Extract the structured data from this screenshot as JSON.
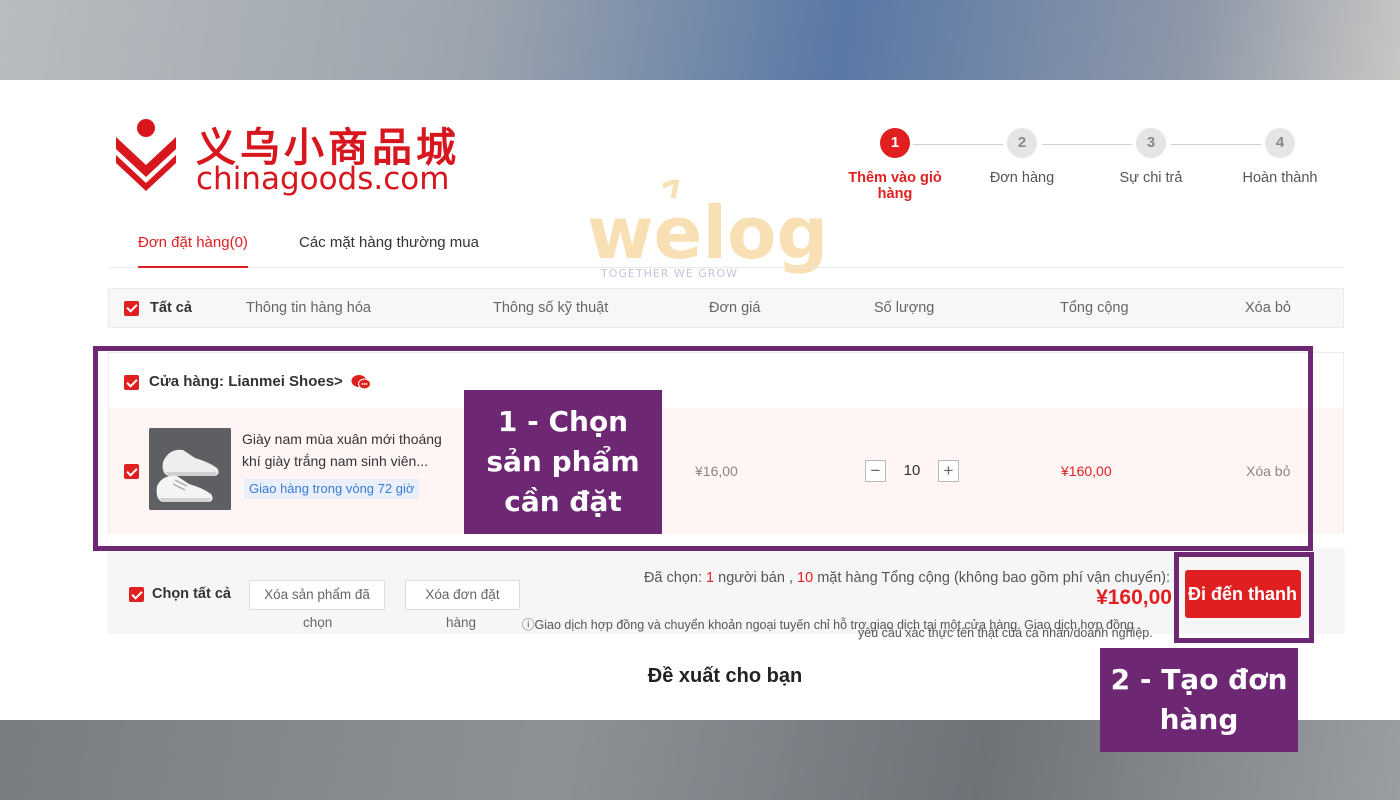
{
  "brand": {
    "logo_cn": "义乌小商品城",
    "logo_en": "chinagoods.com",
    "accent": "#e02020"
  },
  "steps": [
    {
      "num": "1",
      "label": "Thêm vào giỏ hàng",
      "active": true
    },
    {
      "num": "2",
      "label": "Đơn hàng",
      "active": false
    },
    {
      "num": "3",
      "label": "Sự chi trả",
      "active": false
    },
    {
      "num": "4",
      "label": "Hoàn thành",
      "active": false
    }
  ],
  "tabs": {
    "orders": "Đơn đặt hàng(0)",
    "frequent": "Các mặt hàng thường mua"
  },
  "watermark": {
    "word": "welog",
    "tagline": "TOGETHER WE GROW"
  },
  "table_header": {
    "all": "Tất cả",
    "product_info": "Thông tin hàng hóa",
    "specs": "Thông số kỹ thuật",
    "unit_price": "Đơn giá",
    "quantity": "Số lượng",
    "total": "Tổng cộng",
    "delete": "Xóa bỏ"
  },
  "shop": {
    "name": "Cửa hàng: Lianmei Shoes>",
    "chat_icon": "chat-icon"
  },
  "item": {
    "title_line1": "Giày nam mùa xuân mới thoáng",
    "title_line2": "khí giày trắng nam sinh viên...",
    "delivery": "Giao hàng trong vòng 72 giờ",
    "unit_price": "¥16,00",
    "quantity": "10",
    "line_total": "¥160,00",
    "delete": "Xóa bỏ",
    "minus": "−",
    "plus": "+"
  },
  "footer": {
    "select_all": "Chọn tất cả",
    "delete_selected": "Xóa sản phẩm đã",
    "delete_selected_tail": "chọn",
    "delete_order": "Xóa đơn đặt",
    "delete_order_tail": "hàng",
    "summary_prefix": "Đã chọn:",
    "sellers_count": "1",
    "sellers_label": "người bán ,",
    "items_count": "10",
    "items_label": "mặt hàng Tổng cộng (không bao gồm phí vận chuyển):",
    "grand_total": "¥160,00",
    "checkout": "Đi đến thanh",
    "notice_line1": "ⓘGiao dịch hợp đồng và chuyển khoản ngoại tuyến chỉ hỗ trợ giao dịch tại một cửa hàng. Giao dịch hợp đồng",
    "notice_line2": "yêu cầu xác thực tên thật của cá nhân/doanh nghiệp."
  },
  "recommend": "Đề xuất cho bạn",
  "annotations": {
    "step1": "1 - Chọn sản phẩm cần đặt",
    "step2": "2 - Tạo đơn hàng",
    "color": "#6d2773"
  }
}
